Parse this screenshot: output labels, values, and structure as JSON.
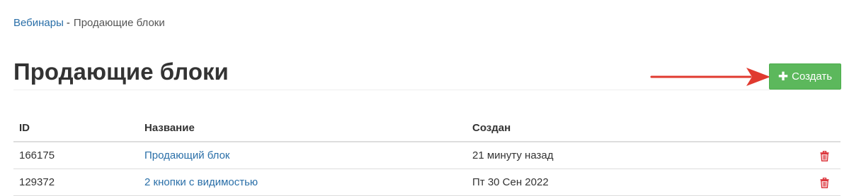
{
  "breadcrumb": {
    "parent": "Вебинары",
    "separator": "-",
    "current": "Продающие блоки"
  },
  "page": {
    "title": "Продающие блоки"
  },
  "toolbar": {
    "create_label": "Создать",
    "create_icon": "plus-icon"
  },
  "table": {
    "columns": {
      "id": "ID",
      "name": "Название",
      "created": "Создан"
    },
    "rows": [
      {
        "id": "166175",
        "name": "Продающий блок",
        "created": "21 минуту назад",
        "action_icon": "trash-icon"
      },
      {
        "id": "129372",
        "name": "2 кнопки с видимостью",
        "created": "Пт 30 Сен 2022",
        "action_icon": "trash-icon"
      }
    ]
  },
  "colors": {
    "link": "#2a6fa8",
    "create_button": "#5cb85c",
    "delete_icon": "#d9272e",
    "annotation_arrow": "#e03a2f"
  }
}
